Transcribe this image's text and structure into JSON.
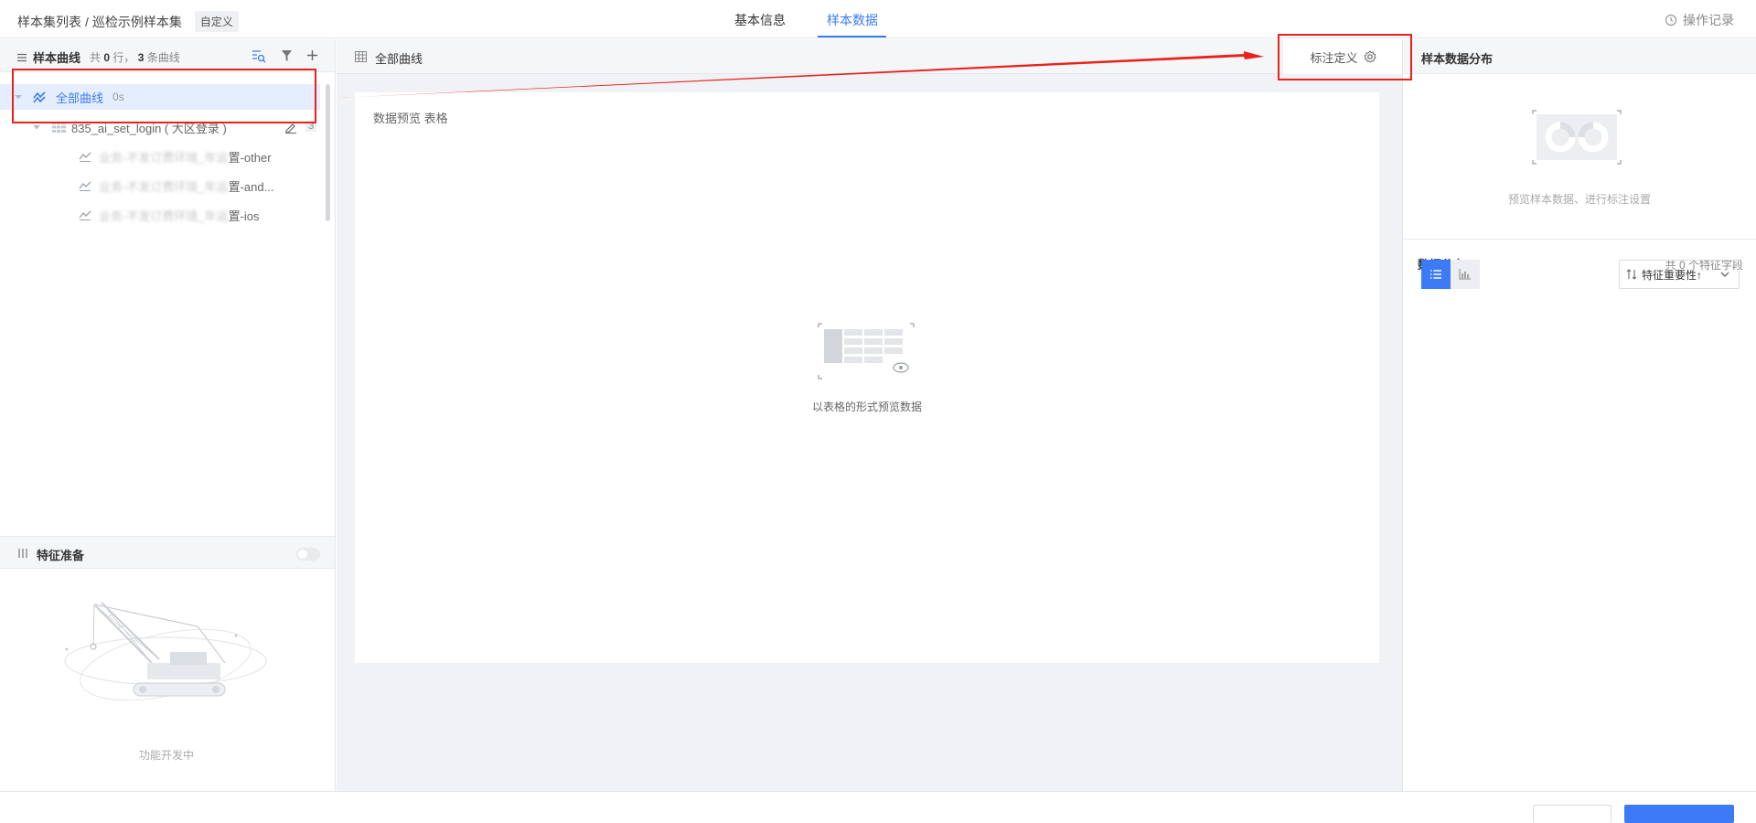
{
  "topbar": {
    "breadcrumb_root": "样本集列表",
    "breadcrumb_sep": "/",
    "breadcrumb_current": "巡检示例样本集",
    "tag": "自定义",
    "tabs": [
      {
        "label": "基本信息",
        "active": false
      },
      {
        "label": "样本数据",
        "active": true
      }
    ],
    "oplog_label": "操作记录"
  },
  "left": {
    "title": "样本曲线",
    "count_prefix": "共",
    "rows_count": "0",
    "rows_suffix": "行，",
    "curves_count": "3",
    "curves_suffix": "条曲线",
    "tree": {
      "all_label": "全部曲线",
      "all_time": "0s",
      "group_label": "835_ai_set_login ( 大区登录 )",
      "group_badge": "3",
      "curves": [
        {
          "blurred": "业务-不发订费环境_年运",
          "suffix": "置-other"
        },
        {
          "blurred": "业务-不发订费环境_年运",
          "suffix": "置-and..."
        },
        {
          "blurred": "业务-不发订费环境_年运",
          "suffix": "置-ios"
        }
      ]
    },
    "feature_title": "特征准备",
    "feature_empty": "功能开发中"
  },
  "center": {
    "header_label": "全部曲线",
    "define_button": "标注定义",
    "card_title": "数据预览 表格",
    "empty_text": "以表格的形式预览数据"
  },
  "right": {
    "header_title": "样本数据分布",
    "preview_hint": "预览样本数据、进行标注设置",
    "dist_title": "数据分布",
    "dist_count": "共 0 个特征字段",
    "sort_label": "特征重要性↑"
  },
  "colors": {
    "accent": "#3c7bf5",
    "annotation_red": "#e8231c",
    "selected_row": "#e5eefe"
  }
}
